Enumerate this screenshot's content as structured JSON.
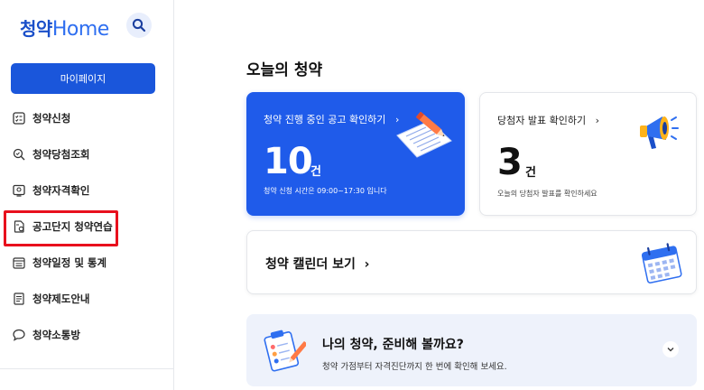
{
  "sidebar": {
    "logo_ko": "청약",
    "logo_en": "Home",
    "mypage_label": "마이페이지",
    "items": [
      {
        "label": "청약신청",
        "icon": "list-check-icon"
      },
      {
        "label": "청약당첨조회",
        "icon": "magnifier-icon"
      },
      {
        "label": "청약자격확인",
        "icon": "id-check-icon"
      },
      {
        "label": "공고단지 청약연습",
        "icon": "practice-doc-icon"
      },
      {
        "label": "청약일정 및 통계",
        "icon": "calendar-list-icon"
      },
      {
        "label": "청약제도안내",
        "icon": "guide-doc-icon"
      },
      {
        "label": "청약소통방",
        "icon": "chat-bubble-icon"
      }
    ],
    "highlight_color": "#e8101d"
  },
  "main": {
    "title": "오늘의 청약",
    "notice_card": {
      "title": "청약 진행 중인 공고 확인하기",
      "arrow": "›",
      "count": "10",
      "unit": "건",
      "note": "청약 신청 시간은 09:00~17:30 입니다",
      "color": "#1f5bea"
    },
    "winner_card": {
      "title": "당첨자 발표 확인하기",
      "arrow": "›",
      "count": "3",
      "unit": "건",
      "note": "오늘의 당첨자 발표를 확인하세요"
    },
    "calendar_card": {
      "title": "청약 캘린더 보기",
      "arrow": "›"
    },
    "prep_card": {
      "title": "나의 청약, 준비해 볼까요?",
      "subtitle": "청약 가점부터 자격진단까지 한 번에 확인해 보세요."
    }
  }
}
